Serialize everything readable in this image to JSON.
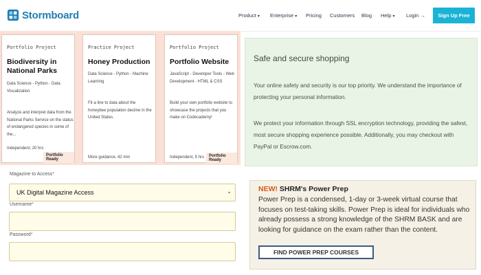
{
  "nav": {
    "logo_text": "Stormboard",
    "links": [
      "Product",
      "Enterprise",
      "Pricing",
      "Customers",
      "Blog",
      "Help",
      "Login"
    ],
    "signup_label": "Sign Up Free",
    "accent_color": "#1ab3d6"
  },
  "cards": [
    {
      "type": "Portfolio Project",
      "title": "Biodiversity in National Parks",
      "tags": "Data Science - Python - Data Visualization",
      "desc": "Analyze and interpret data from the National Parks Service on the status of endangered species in some of the...",
      "meta": "Independent, 20 hrs",
      "badge": "Portfolio Ready"
    },
    {
      "type": "Practice Project",
      "title": "Honey Production",
      "tags": "Data Science - Python - Machine Learning",
      "desc": "Fit a line to data about the honeybee population decline in the United States.",
      "meta": "More guidance, 42 min",
      "badge": ""
    },
    {
      "type": "Portfolio Project",
      "title": "Portfolio Website",
      "tags": "JavaScript - Developer Tools - Web Development - HTML & CSS",
      "desc": "Build your own portfolio website to showcase the projects that you make on Codecademy!",
      "meta": "Independent, 5 hrs",
      "badge": "Portfolio Ready"
    }
  ],
  "secure": {
    "title": "Safe and secure shopping",
    "para1": "Your online safety and security is our top priority. We understand the importance of protecting your personal information.",
    "para2": "We protect your information through SSL encryption technology, providing the safest, most secure shopping experience possible. Additionally, you may checkout with PayPal or Escrow.com."
  },
  "form": {
    "magazine_label": "Magazine to Access",
    "magazine_value": "UK Digital Magazine Access",
    "username_label": "Username",
    "password_label": "Password",
    "required_mark": "*"
  },
  "promo": {
    "new_label": "NEW!",
    "title": "SHRM's Power Prep",
    "body": "Power Prep is a condensed, 1-day or 3-week virtual course that focuses on test-taking skills. Power Prep is ideal for individuals who already possess a strong knowledge of the SHRM BASK and are looking for guidance on the exam rather than the content.",
    "button_label": "FIND POWER PREP COURSES"
  }
}
